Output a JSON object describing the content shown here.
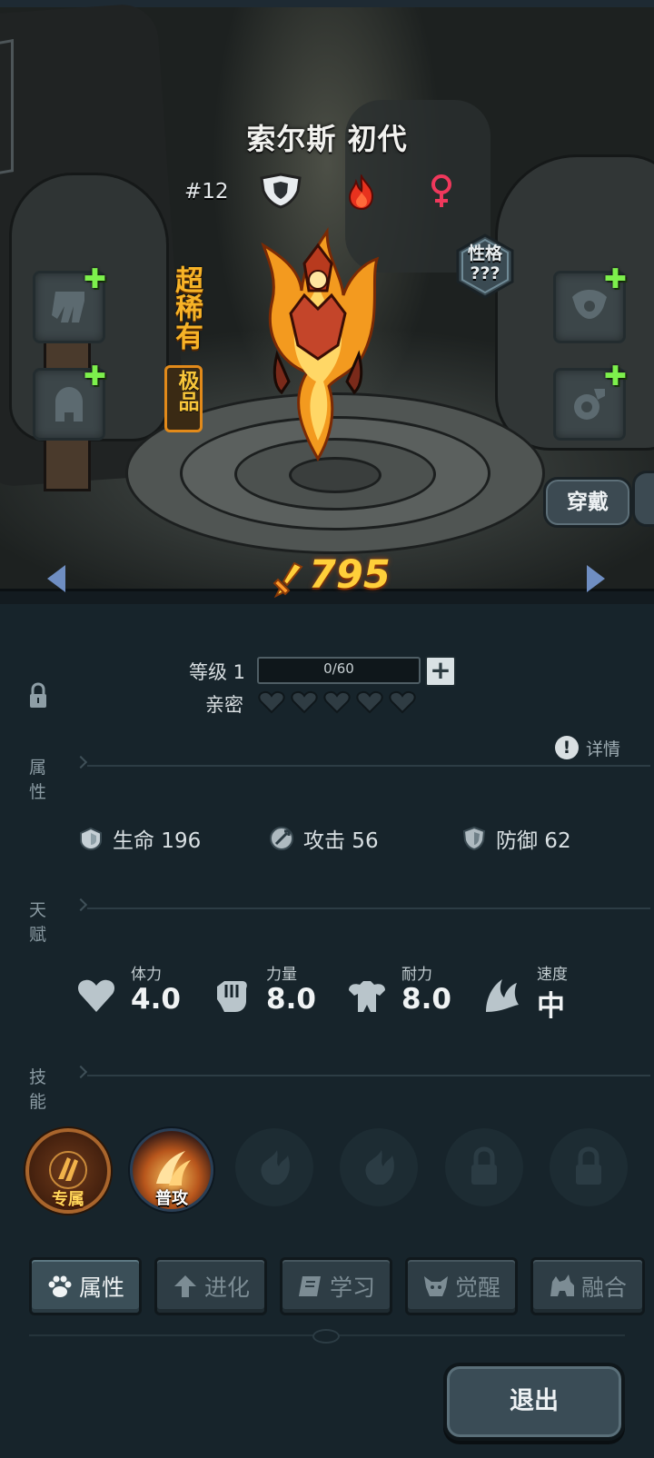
{
  "creature": {
    "name": "索尔斯 初代",
    "number": "#12",
    "rarity": "超稀有",
    "quality": "极品",
    "personality": "性格\n???",
    "power": "795"
  },
  "buttons": {
    "wear": "穿戴",
    "exit": "退出"
  },
  "level": {
    "label": "等级 1",
    "exp_text": "0/60",
    "exp_progress": 0
  },
  "intimacy": {
    "label": "亲密",
    "hearts_filled": 0,
    "hearts_total": 5
  },
  "detail_label": "详情",
  "sections": {
    "attributes": "属性",
    "talent": "天赋",
    "skills": "技能"
  },
  "stats": {
    "hp": "生命 196",
    "attack": "攻击 56",
    "defense": "防御 62"
  },
  "talents": [
    {
      "label": "体力",
      "value": "4.0",
      "icon": "heart-icon"
    },
    {
      "label": "力量",
      "value": "8.0",
      "icon": "fist-icon"
    },
    {
      "label": "耐力",
      "value": "8.0",
      "icon": "armor-icon"
    },
    {
      "label": "速度",
      "value": "中",
      "icon": "wing-icon"
    }
  ],
  "skills": [
    {
      "badge": "专属",
      "state": "unlocked"
    },
    {
      "badge": "普攻",
      "state": "unlocked"
    },
    {
      "badge": "",
      "state": "empty"
    },
    {
      "badge": "",
      "state": "empty"
    },
    {
      "badge": "",
      "state": "locked"
    },
    {
      "badge": "",
      "state": "locked"
    }
  ],
  "tabs": [
    {
      "label": "属性",
      "icon": "paw-icon",
      "active": true
    },
    {
      "label": "进化",
      "icon": "arrow-up-icon",
      "active": false
    },
    {
      "label": "学习",
      "icon": "book-icon",
      "active": false
    },
    {
      "label": "觉醒",
      "icon": "horned-head-icon",
      "active": false
    },
    {
      "label": "融合",
      "icon": "beast-icon",
      "active": false
    }
  ],
  "colors": {
    "accent_gold": "#ffcf3a",
    "plus_green": "#7df04c",
    "fire_red": "#e8321e",
    "female_pink": "#f0385c"
  }
}
